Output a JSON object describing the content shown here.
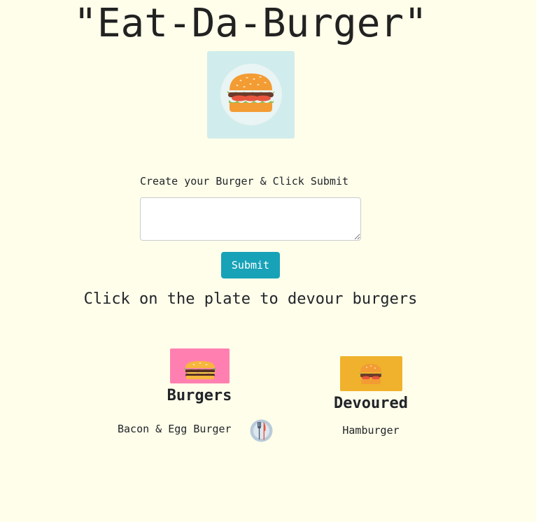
{
  "header": {
    "title": "\"Eat-Da-Burger\"",
    "logo_icon": "burger-icon"
  },
  "form": {
    "label": "Create your Burger & Click Submit",
    "input_value": "",
    "submit_label": "Submit"
  },
  "instructions": "Click on the plate to devour burgers",
  "burgers": {
    "heading": "Burgers",
    "badge_color": "#ff80b0",
    "items": [
      {
        "name": "Bacon & Egg Burger",
        "action_icon": "plate-fork-knife-icon"
      }
    ]
  },
  "devoured": {
    "heading": "Devoured",
    "badge_color": "#f0b22d",
    "items": [
      {
        "name": "Hamburger"
      }
    ]
  },
  "colors": {
    "background": "#fffeea",
    "submit": "#17a2b8",
    "logo_bg": "#d1ecec"
  }
}
